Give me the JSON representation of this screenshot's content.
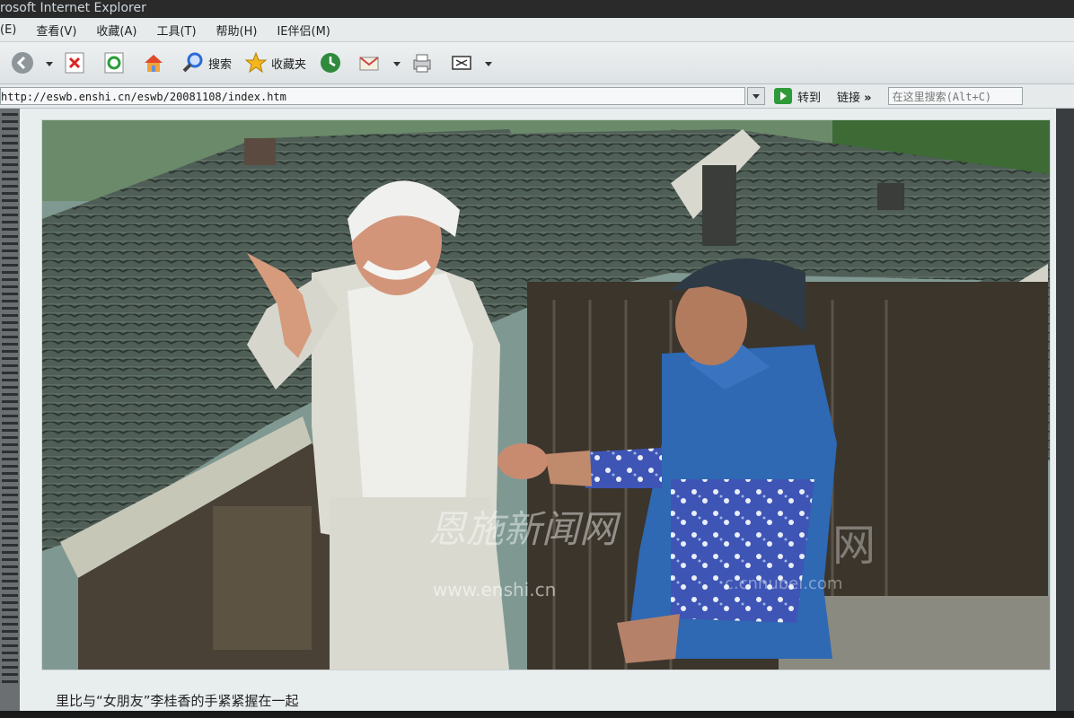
{
  "window": {
    "title": "rosoft Internet Explorer"
  },
  "menu": [
    "(E)",
    "查看(V)",
    "收藏(A)",
    "工具(T)",
    "帮助(H)",
    "IE伴侣(M)"
  ],
  "toolbar": {
    "search_label": "搜索",
    "favorites_label": "收藏夹"
  },
  "address": {
    "url": "http://eswb.enshi.cn/eswb/20081108/index.htm",
    "go_label": "转到",
    "links_label": "链接",
    "search_placeholder": "在这里搜索(Alt+C)"
  },
  "photo": {
    "watermark_1": "www.enshi.cn",
    "watermark_2": "网",
    "watermark_3": "c.cnhubei.com"
  },
  "caption": "里比与“女朋友”李桂香的手紧紧握在一起",
  "colors": {
    "roof": "#4b5a52",
    "jacket_blue": "#2f68b3",
    "sky": "#6f8c86",
    "ui_bg": "#e8edee"
  }
}
